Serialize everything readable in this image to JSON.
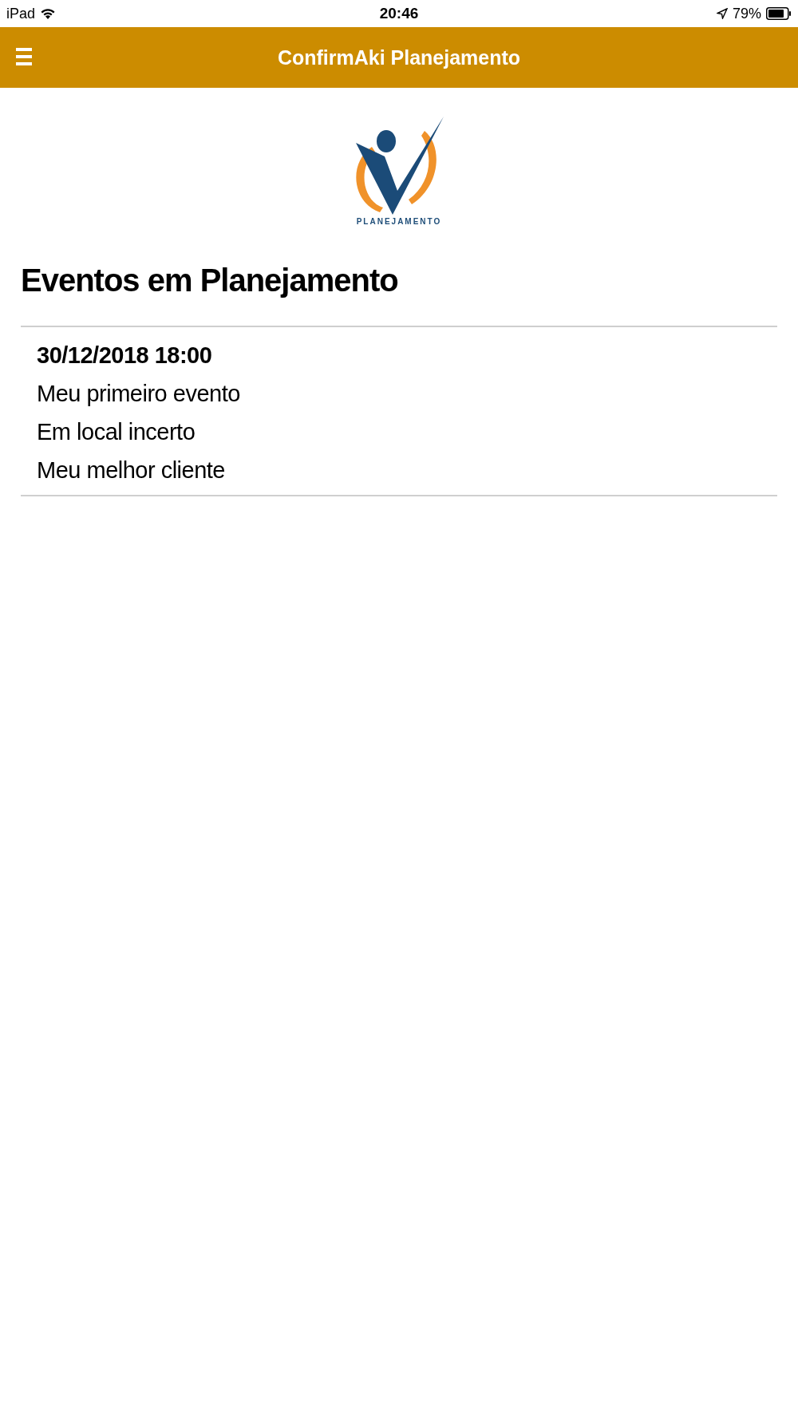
{
  "status_bar": {
    "device": "iPad",
    "time": "20:46",
    "battery": "79%"
  },
  "header": {
    "title": "ConfirmAki Planejamento"
  },
  "logo": {
    "caption": "PLANEJAMENTO"
  },
  "heading": "Eventos em Planejamento",
  "events": [
    {
      "datetime": "30/12/2018 18:00",
      "name": "Meu primeiro evento",
      "location": "Em local incerto",
      "client": "Meu melhor cliente"
    }
  ]
}
